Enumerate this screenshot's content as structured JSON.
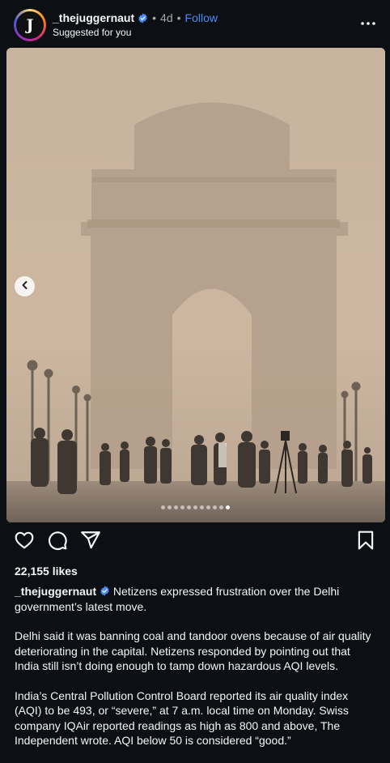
{
  "post": {
    "author": {
      "username": "_thejuggernaut",
      "avatar_letter": "J",
      "verified": true,
      "time_ago": "4d",
      "follow_label": "Follow",
      "subtitle": "Suggested for you"
    },
    "carousel": {
      "slide_count": 11,
      "active_index": 10
    },
    "likes": "22,155 likes",
    "caption": {
      "username": "_thejuggernaut",
      "paragraph_1": "Netizens expressed frustration over the Delhi government’s latest move.",
      "paragraph_2": "Delhi said it was banning coal and tandoor ovens because of air quality deteriorating in the capital. Netizens responded by pointing out that India still isn’t doing enough to tamp down hazardous AQI levels.",
      "paragraph_3": "India’s Central Pollution Control Board reported its air quality index (AQI) to be 493, or “severe,” at 7 a.m. local time on Monday. Swiss company IQAir reported readings as high as 800 and above, The Independent wrote. AQI below 50 is considered “good.”"
    }
  },
  "icons": {
    "more": "more-options-icon",
    "like": "heart-icon",
    "comment": "comment-icon",
    "share": "send-icon",
    "save": "bookmark-icon",
    "prev": "chevron-left-icon",
    "verified": "verified-badge-icon"
  },
  "colors": {
    "background": "#0c1014",
    "accent": "#4a8cf7",
    "verified": "#4a8cf7"
  }
}
